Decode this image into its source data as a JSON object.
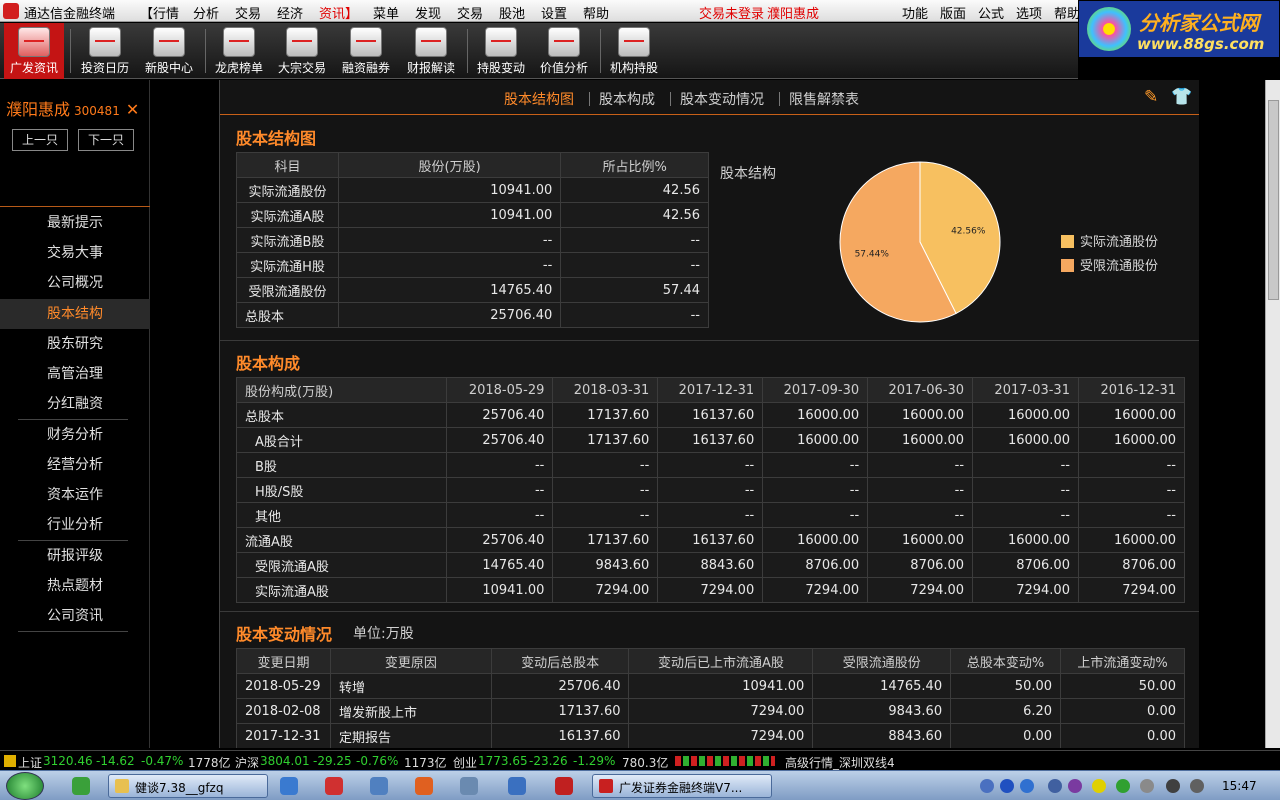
{
  "app": {
    "title": "通达信金融终端",
    "menus": [
      "【行情",
      "分析",
      "交易",
      "经济",
      "资讯】",
      "菜单",
      "发现",
      "交易",
      "股池",
      "设置",
      "帮助"
    ],
    "status_login": "交易未登录",
    "status_stock": "濮阳惠成",
    "right_menus": [
      "功能",
      "版面",
      "公式",
      "选项",
      "帮助"
    ]
  },
  "ad": {
    "title": "分析家公式网",
    "url": "www.88gs.com"
  },
  "toolbar": {
    "items": [
      "广发资讯",
      "投资日历",
      "新股中心",
      "龙虎榜单",
      "大宗交易",
      "融资融券",
      "财报解读",
      "持股变动",
      "价值分析",
      "机构持股"
    ]
  },
  "sidebar": {
    "stock_name": "濮阳惠成",
    "stock_code": "300481",
    "close": "✕",
    "prev": "上一只",
    "next": "下一只",
    "items": [
      "最新提示",
      "交易大事",
      "公司概况",
      "股本结构",
      "股东研究",
      "高管治理",
      "分红融资",
      "财务分析",
      "经营分析",
      "资本运作",
      "行业分析",
      "研报评级",
      "热点题材",
      "公司资讯"
    ]
  },
  "tabs": [
    "股本结构图",
    "股本构成",
    "股本变动情况",
    "限售解禁表"
  ],
  "colors": {
    "accent": "#ff8a2a",
    "pie_a": "#f7c060",
    "pie_b": "#f5a860"
  },
  "section1": {
    "title": "股本结构图",
    "headers": [
      "科目",
      "股份(万股)",
      "所占比例%"
    ],
    "rows": [
      [
        "实际流通股份",
        "10941.00",
        "42.56"
      ],
      [
        "实际流通A股",
        "10941.00",
        "42.56"
      ],
      [
        "实际流通B股",
        "--",
        "--"
      ],
      [
        "实际流通H股",
        "--",
        "--"
      ],
      [
        "受限流通股份",
        "14765.40",
        "57.44"
      ],
      [
        "总股本",
        "25706.40",
        "--"
      ]
    ],
    "pie_title": "股本结构",
    "pie_labels": [
      "42.56%",
      "57.44%"
    ],
    "legend": [
      "实际流通股份",
      "受限流通股份"
    ]
  },
  "chart_data": {
    "type": "pie",
    "title": "股本结构",
    "categories": [
      "实际流通股份",
      "受限流通股份"
    ],
    "values": [
      42.56,
      57.44
    ],
    "legend": "right"
  },
  "section2": {
    "title": "股本构成",
    "headers": [
      "股份构成(万股)",
      "2018-05-29",
      "2018-03-31",
      "2017-12-31",
      "2017-09-30",
      "2017-06-30",
      "2017-03-31",
      "2016-12-31"
    ],
    "rows": [
      [
        "总股本",
        "25706.40",
        "17137.60",
        "16137.60",
        "16000.00",
        "16000.00",
        "16000.00",
        "16000.00"
      ],
      [
        "A股合计",
        "25706.40",
        "17137.60",
        "16137.60",
        "16000.00",
        "16000.00",
        "16000.00",
        "16000.00"
      ],
      [
        "B股",
        "--",
        "--",
        "--",
        "--",
        "--",
        "--",
        "--"
      ],
      [
        "H股/S股",
        "--",
        "--",
        "--",
        "--",
        "--",
        "--",
        "--"
      ],
      [
        "其他",
        "--",
        "--",
        "--",
        "--",
        "--",
        "--",
        "--"
      ],
      [
        "流通A股",
        "25706.40",
        "17137.60",
        "16137.60",
        "16000.00",
        "16000.00",
        "16000.00",
        "16000.00"
      ],
      [
        "受限流通A股",
        "14765.40",
        "9843.60",
        "8843.60",
        "8706.00",
        "8706.00",
        "8706.00",
        "8706.00"
      ],
      [
        "实际流通A股",
        "10941.00",
        "7294.00",
        "7294.00",
        "7294.00",
        "7294.00",
        "7294.00",
        "7294.00"
      ]
    ]
  },
  "section3": {
    "title": "股本变动情况",
    "unit": "单位:万股",
    "headers": [
      "变更日期",
      "变更原因",
      "变动后总股本",
      "变动后已上市流通A股",
      "受限流通股份",
      "总股本变动%",
      "上市流通变动%"
    ],
    "rows": [
      [
        "2018-05-29",
        "转增",
        "25706.40",
        "10941.00",
        "14765.40",
        "50.00",
        "50.00"
      ],
      [
        "2018-02-08",
        "增发新股上市",
        "17137.60",
        "7294.00",
        "9843.60",
        "6.20",
        "0.00"
      ],
      [
        "2017-12-31",
        "定期报告",
        "16137.60",
        "7294.00",
        "8843.60",
        "0.00",
        "0.00"
      ]
    ]
  },
  "ticker": {
    "sh_name": "上证",
    "sh_val": "3120.46",
    "sh_chg": "-14.62",
    "sh_pct": "-0.47%",
    "sh_amt": "1778亿",
    "sz_name": "沪深",
    "sz_val": "3804.01",
    "sz_chg": "-29.25",
    "sz_pct": "-0.76%",
    "sz_amt": "1173亿",
    "cy_name": "创业",
    "cy_val": "1773.65",
    "cy_chg": "-23.26",
    "cy_pct": "-1.29%",
    "cy_amt": "780.3亿",
    "server": "高级行情_深圳双线4"
  },
  "taskbar": {
    "tasks": [
      "健谈7.38__gfzq",
      "广发证券金融终端V7..."
    ],
    "time": "15:47"
  }
}
